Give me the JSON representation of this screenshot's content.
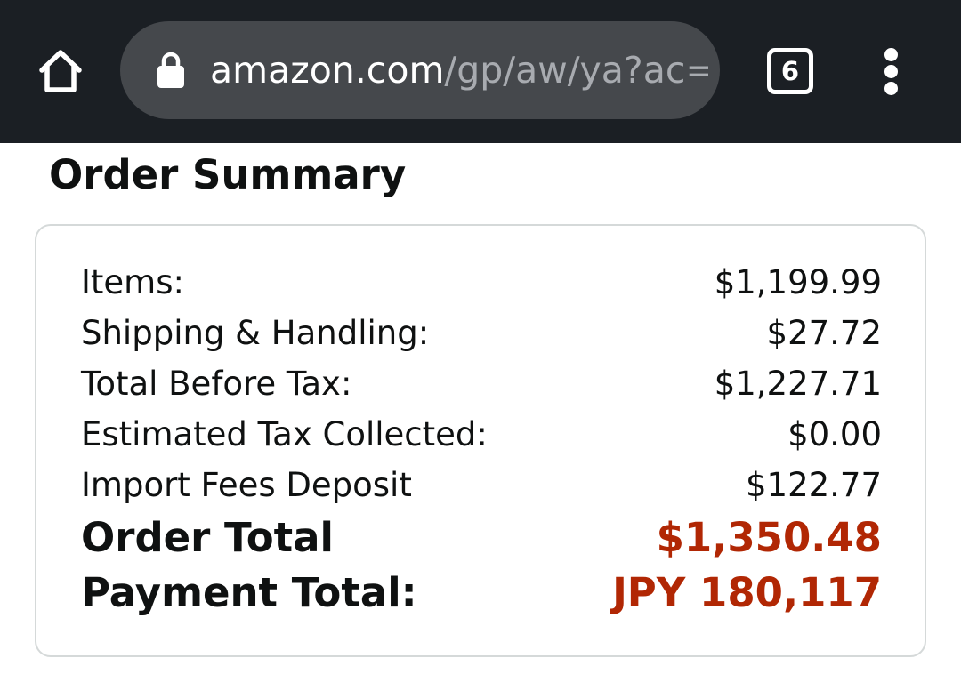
{
  "browser": {
    "url_domain": "amazon.com",
    "url_path": "/gp/aw/ya?ac=",
    "tab_count": "6"
  },
  "page": {
    "title": "Order Summary"
  },
  "summary": {
    "rows": [
      {
        "label": "Items:",
        "value": "$1,199.99"
      },
      {
        "label": "Shipping & Handling:",
        "value": "$27.72"
      },
      {
        "label": "Total Before Tax:",
        "value": "$1,227.71"
      },
      {
        "label": "Estimated Tax Collected:",
        "value": "$0.00"
      },
      {
        "label": "Import Fees Deposit",
        "value": "$122.77"
      }
    ],
    "order_total": {
      "label": "Order Total",
      "value": "$1,350.48"
    },
    "payment_total": {
      "label": "Payment Total:",
      "value": "JPY 180,117"
    }
  },
  "colors": {
    "toolbar_bg": "#1b1f24",
    "urlbar_bg": "#45484c",
    "total_accent": "#b12704",
    "border": "#d5d9d9"
  },
  "icons": [
    "home-icon",
    "lock-icon",
    "tab-switcher-icon",
    "more-vert-icon"
  ]
}
